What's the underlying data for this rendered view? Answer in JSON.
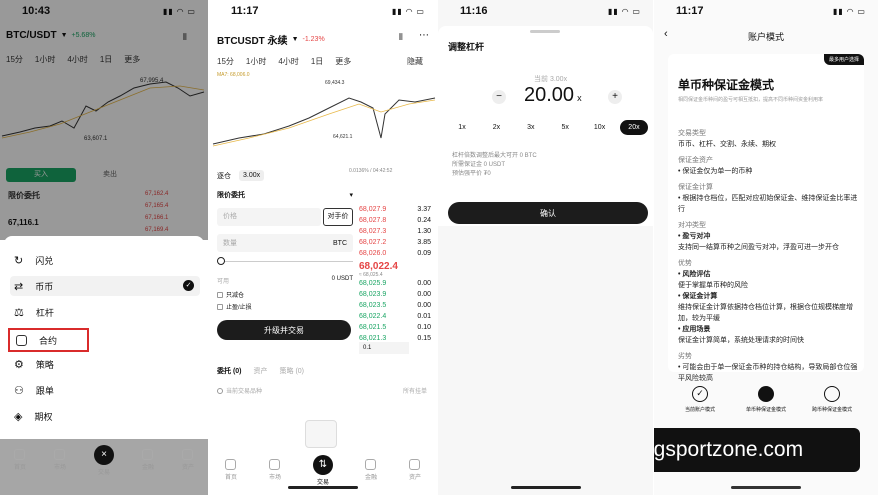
{
  "p1": {
    "time": "10:43",
    "pair": "BTC/USDT",
    "change": "+5.68%",
    "intervals": [
      "15分",
      "1小时",
      "4小时",
      "1日",
      "更多"
    ],
    "chart_hi": "67,995.4",
    "chart_lo": "63,607.1",
    "buy_btn": "买入",
    "sell_btn": "卖出",
    "order_type": "限价委托",
    "prices": [
      "67,162.4",
      "67,165.4",
      "67,166.1",
      "67,169.4"
    ],
    "mid_price": "67,116.1",
    "menu": [
      {
        "label": "闪兑",
        "icon": "flash-icon"
      },
      {
        "label": "币币",
        "icon": "swap-icon"
      },
      {
        "label": "杠杆",
        "icon": "leverage-icon"
      },
      {
        "label": "合约",
        "icon": "contract-icon"
      },
      {
        "label": "策略",
        "icon": "strategy-icon"
      },
      {
        "label": "跟单",
        "icon": "copy-trade-icon"
      },
      {
        "label": "期权",
        "icon": "options-icon"
      }
    ],
    "tabs": [
      "首页",
      "市场",
      "交易",
      "金融",
      "资产"
    ],
    "highlight_color": "#d92b2b"
  },
  "p2": {
    "time": "11:17",
    "pair": "BTCUSDT 永续",
    "change": "-1.23%",
    "intervals": [
      "15分",
      "1小时",
      "4小时",
      "1日",
      "更多"
    ],
    "hide": "隐藏",
    "ma": "MA7: 68,006.0",
    "hi": "69,434.3",
    "lo": "64,621.1",
    "margin_mode": "逐仓",
    "leverage": "3.00x",
    "order_type": "限价委托",
    "price_ph": "价格",
    "counter_price": "对手价",
    "qty_ph": "数量",
    "unit": "BTC",
    "avail": "可用",
    "avail_val": "0 USDT",
    "reduce": "只减仓",
    "tp_sl": "止盈/止损",
    "action": "升级并交易",
    "funding": "0.0136% / 04:42:52",
    "asks": [
      "68,027.9",
      "68,027.8",
      "68,027.3",
      "68,027.2",
      "68,026.0"
    ],
    "ask_qty": [
      "3.37",
      "0.24",
      "1.30",
      "3.85",
      "0.09"
    ],
    "last": "68,022.4",
    "mark": "≈ 68,025.4",
    "bids": [
      "68,025.9",
      "68,023.9",
      "68,023.5",
      "68,022.4",
      "68,021.5",
      "68,021.3"
    ],
    "bid_qty": [
      "0.00",
      "0.00",
      "0.00",
      "0.01",
      "0.10",
      "0.15"
    ],
    "step": "0.1",
    "bottom_tabs": [
      "委托 (0)",
      "资产",
      "策略 (0)"
    ],
    "only_pair": "当前交易品种",
    "all_orders": "所有挂单",
    "tabs": [
      "首页",
      "市场",
      "交易",
      "金融",
      "资产"
    ]
  },
  "p3": {
    "time": "11:16",
    "title": "调整杠杆",
    "current": "当前 3.00x",
    "value": "20.00",
    "unit": "x",
    "presets": [
      "1x",
      "2x",
      "3x",
      "5x",
      "10x",
      "20x"
    ],
    "info": [
      "杠杆倍数调整后最大可开 0 BTC",
      "所需保证金 0 USDT",
      "预估强平价 ₮0"
    ],
    "confirm": "确认"
  },
  "p4": {
    "time": "11:17",
    "title": "账户模式",
    "badge": "最多用户选择",
    "heading": "单币种保证金模式",
    "desc": "相同保证金币种间的盈亏可相互抵扣，提高不同币种间资金利用率",
    "sections": [
      {
        "h": "交易类型",
        "t": [
          "币币、杠杆、交割、永续、期权"
        ]
      },
      {
        "h": "保证金资产",
        "t": [
          "• 保证金仅为单一的币种"
        ]
      },
      {
        "h": "保证金计算",
        "t": [
          "• 根据持仓档位，匹配对应初始保证金、维持保证金比率进",
          "  行"
        ]
      },
      {
        "h": "对冲类型",
        "t": [
          "• 盈亏对冲",
          "  支持同一结算币种之间盈亏对冲，浮盈可进一步开仓"
        ]
      },
      {
        "h": "优势",
        "t": [
          "• 风险评估",
          "  便于掌握单币种的风险",
          "• 保证金计算",
          "  维持保证金计算依据持仓档位计算，根据仓位规模梯度增",
          "  加，较为平缓",
          "• 应用场景",
          "  保证金计算简单，系统处理请求的时间快"
        ]
      },
      {
        "h": "劣势",
        "t": [
          "• 可能会由于单一保证金币种的持仓结构，导致局部仓位强",
          "  平风险较高"
        ]
      }
    ],
    "modes": [
      "当前账户模式",
      "单币种保证金模式",
      "跨币种保证金模式"
    ],
    "watermark": "ngsportzone.com"
  }
}
